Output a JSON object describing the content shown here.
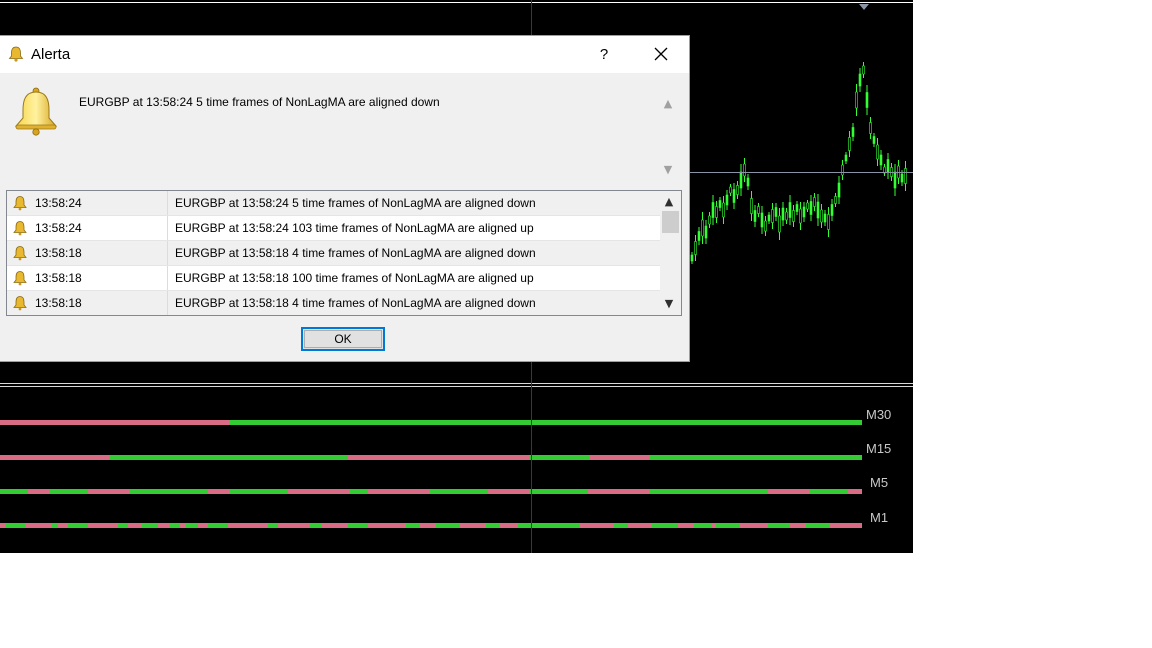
{
  "dialog": {
    "title": "Alerta",
    "help_label": "?",
    "alert_message": "EURGBP at 13:58:24 5 time frames of NonLagMA are aligned down",
    "ok_label": "OK"
  },
  "alerts": [
    {
      "time": "13:58:24",
      "message": "EURGBP at 13:58:24 5 time frames of NonLagMA are aligned down"
    },
    {
      "time": "13:58:24",
      "message": "EURGBP at 13:58:24 103 time frames of NonLagMA are aligned up"
    },
    {
      "time": "13:58:18",
      "message": "EURGBP at 13:58:18 4 time frames of NonLagMA are aligned down"
    },
    {
      "time": "13:58:18",
      "message": "EURGBP at 13:58:18 100 time frames of NonLagMA are aligned up"
    },
    {
      "time": "13:58:18",
      "message": "EURGBP at 13:58:18 4 time frames of NonLagMA are aligned down"
    }
  ],
  "timeframes": {
    "m30": "M30",
    "m15": "M15",
    "m5": "M5",
    "m1": "M1"
  },
  "colors": {
    "up": "#33cc33",
    "down": "#d96b84",
    "candles": "#33ff33",
    "cursor_line": "#c00000"
  },
  "icons": {
    "bell": "bell-icon",
    "close": "close-icon"
  }
}
